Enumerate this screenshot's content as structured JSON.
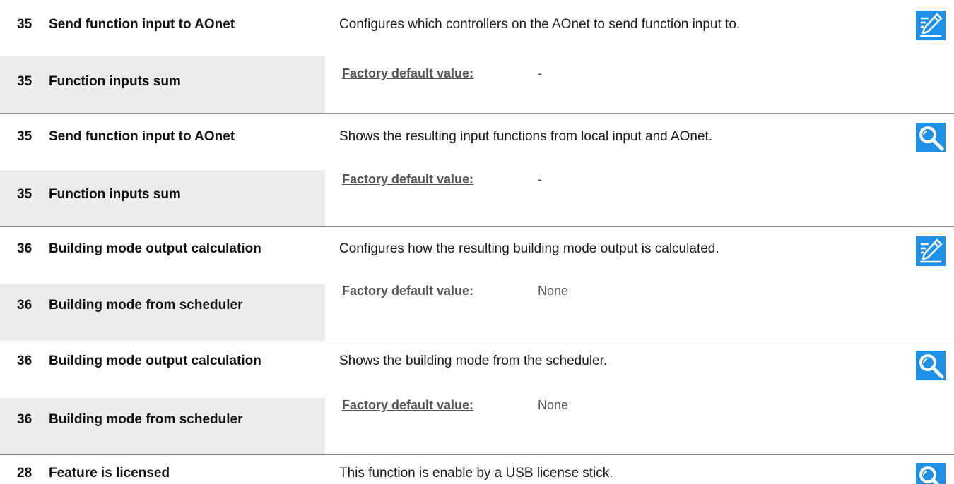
{
  "entries": [
    {
      "top_number": "35",
      "top_name": "Send function input to AOnet",
      "bottom_number": "35",
      "bottom_name": "Function inputs sum",
      "description": "Configures which controllers on the AOnet to send function input to.",
      "factory_default_label": "Factory default value:",
      "factory_default_value": "-",
      "icon": "edit-icon"
    },
    {
      "top_number": "35",
      "top_name": "Send function input to AOnet",
      "bottom_number": "35",
      "bottom_name": "Function inputs sum",
      "description": "Shows the resulting input functions from local input and AOnet.",
      "factory_default_label": "Factory default value:",
      "factory_default_value": "-",
      "icon": "search-icon"
    },
    {
      "top_number": "36",
      "top_name": "Building mode output calculation",
      "bottom_number": "36",
      "bottom_name": "Building mode from scheduler",
      "description": "Configures how the resulting building mode output is calculated.",
      "factory_default_label": "Factory default value:",
      "factory_default_value": "None",
      "icon": "edit-icon"
    },
    {
      "top_number": "36",
      "top_name": "Building mode output calculation",
      "bottom_number": "36",
      "bottom_name": "Building mode from scheduler",
      "description": "Shows the building mode from the scheduler.",
      "factory_default_label": "Factory default value:",
      "factory_default_value": "None",
      "icon": "search-icon"
    },
    {
      "top_number": "28",
      "top_name": "Feature is licensed",
      "description": "This function is enable by a USB license stick.",
      "icon": "search-icon"
    }
  ],
  "colors": {
    "icon_background": "#1e90e6",
    "shaded_cell": "#ececec",
    "divider": "#8a8a8a"
  }
}
